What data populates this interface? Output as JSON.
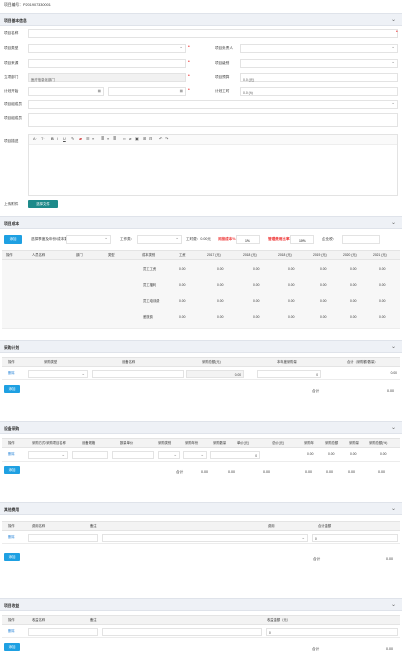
{
  "header": {
    "project_no_label": "项目编号：",
    "project_no": "P201907330001"
  },
  "section_basic": {
    "title": "项目基本信息",
    "fields": {
      "project_name": "项目名称",
      "project_type": "项目类型",
      "project_source": "项目来源",
      "owner_dept": "立项部门",
      "owner_dept_value": "医疗信息化部门",
      "plan_start": "计划开始",
      "responsible": "项目负责人",
      "project_level": "项目级别",
      "hours_budget": "项目预算",
      "hours_budget_value": "0.0 (元)",
      "plan_hours": "计划工时",
      "plan_hours_value": "0.0 (h)",
      "members_a": "项目组成员",
      "members_b": "项目组成员",
      "description": "项目描述",
      "attachment": "上传附件",
      "upload_btn": "选择文件"
    }
  },
  "section_cost": {
    "title": "项目成本",
    "add_btn": "添加",
    "quarter_label": "选择季度及年份/成本数：",
    "type_label": "工作类：",
    "coef_label": "工时费：0.00元",
    "overhead_label": "间接成本%",
    "overhead_val": "1%",
    "mgmt_label": "管理费用比率",
    "mgmt_val": "10%",
    "tax_label": "企业税：",
    "columns": [
      "操作",
      "人员名称",
      "部门",
      "类型",
      "成本类别",
      "工资",
      "2017 (元)",
      "2018 (元)",
      "2018 (元)",
      "2019 (元)",
      "2020 (元)",
      "2021 (元)"
    ],
    "rows": [
      {
        "category": "员工工资",
        "values": [
          "0.00",
          "0.00",
          "0.00",
          "0.00",
          "0.00",
          "0.00",
          "0.00"
        ]
      },
      {
        "category": "员工福利",
        "values": [
          "0.00",
          "0.00",
          "0.00",
          "0.00",
          "0.00",
          "0.00",
          "0.00"
        ]
      },
      {
        "category": "员工培训费",
        "values": [
          "0.00",
          "0.00",
          "0.00",
          "0.00",
          "0.00",
          "0.00",
          "0.00"
        ]
      },
      {
        "category": "差旅费",
        "values": [
          "0.00",
          "0.00",
          "0.00",
          "0.00",
          "0.00",
          "0.00",
          "0.00"
        ]
      }
    ]
  },
  "section_purchase": {
    "title": "采购计划",
    "columns": [
      "操作",
      "采购类型",
      "设备名称",
      "采购总额(元)",
      "本年度采购量",
      "合计（采购额/数量）"
    ],
    "row": {
      "action": "删除",
      "amount": "0.00",
      "qty": "0",
      "total": "0.00"
    },
    "add_btn": "添加",
    "sum_label": "合计",
    "sum_value": "0.00"
  },
  "section_equipment": {
    "title": "设备采购",
    "columns": [
      "操作",
      "采购方式/采购项目名称",
      "设备规格",
      "数量单价",
      "采购类别",
      "采购年份",
      "采购数量",
      "单价(元)",
      "总价(元)",
      "采购年",
      "采购总额",
      "采购量",
      "采购总额(%)"
    ],
    "row": {
      "action": "删除",
      "qty": "0",
      "v1": "0.00",
      "v2": "0.00",
      "v3": "0.00",
      "v4": "0.00"
    },
    "add_btn": "添加",
    "sum_label": "合计",
    "sums": [
      "0.00",
      "0.00",
      "0.00",
      "0.00",
      "0.00",
      "0.00",
      "0.00"
    ]
  },
  "section_other": {
    "title": "其他费用",
    "columns": [
      "操作",
      "费用名称",
      "备注",
      "费用",
      "合计金额"
    ],
    "row": {
      "action": "删除",
      "amount": "0"
    },
    "add_btn": "添加",
    "sum_label": "合计",
    "sum_value": "0.00"
  },
  "section_income": {
    "title": "项目收益",
    "columns": [
      "操作",
      "收益名称",
      "备注",
      "收益金额（元）"
    ],
    "row": {
      "action": "删除",
      "amount": "0"
    },
    "add_btn": "添加",
    "sum_label": "合计",
    "sum_value": "0.00"
  },
  "editor": {
    "toolbar": [
      "A",
      "T",
      "B",
      "I",
      "U",
      "≡",
      "≣",
      "☰",
      "⇤",
      "⇥",
      "🔗",
      "⊞",
      "↶",
      "↷"
    ]
  }
}
